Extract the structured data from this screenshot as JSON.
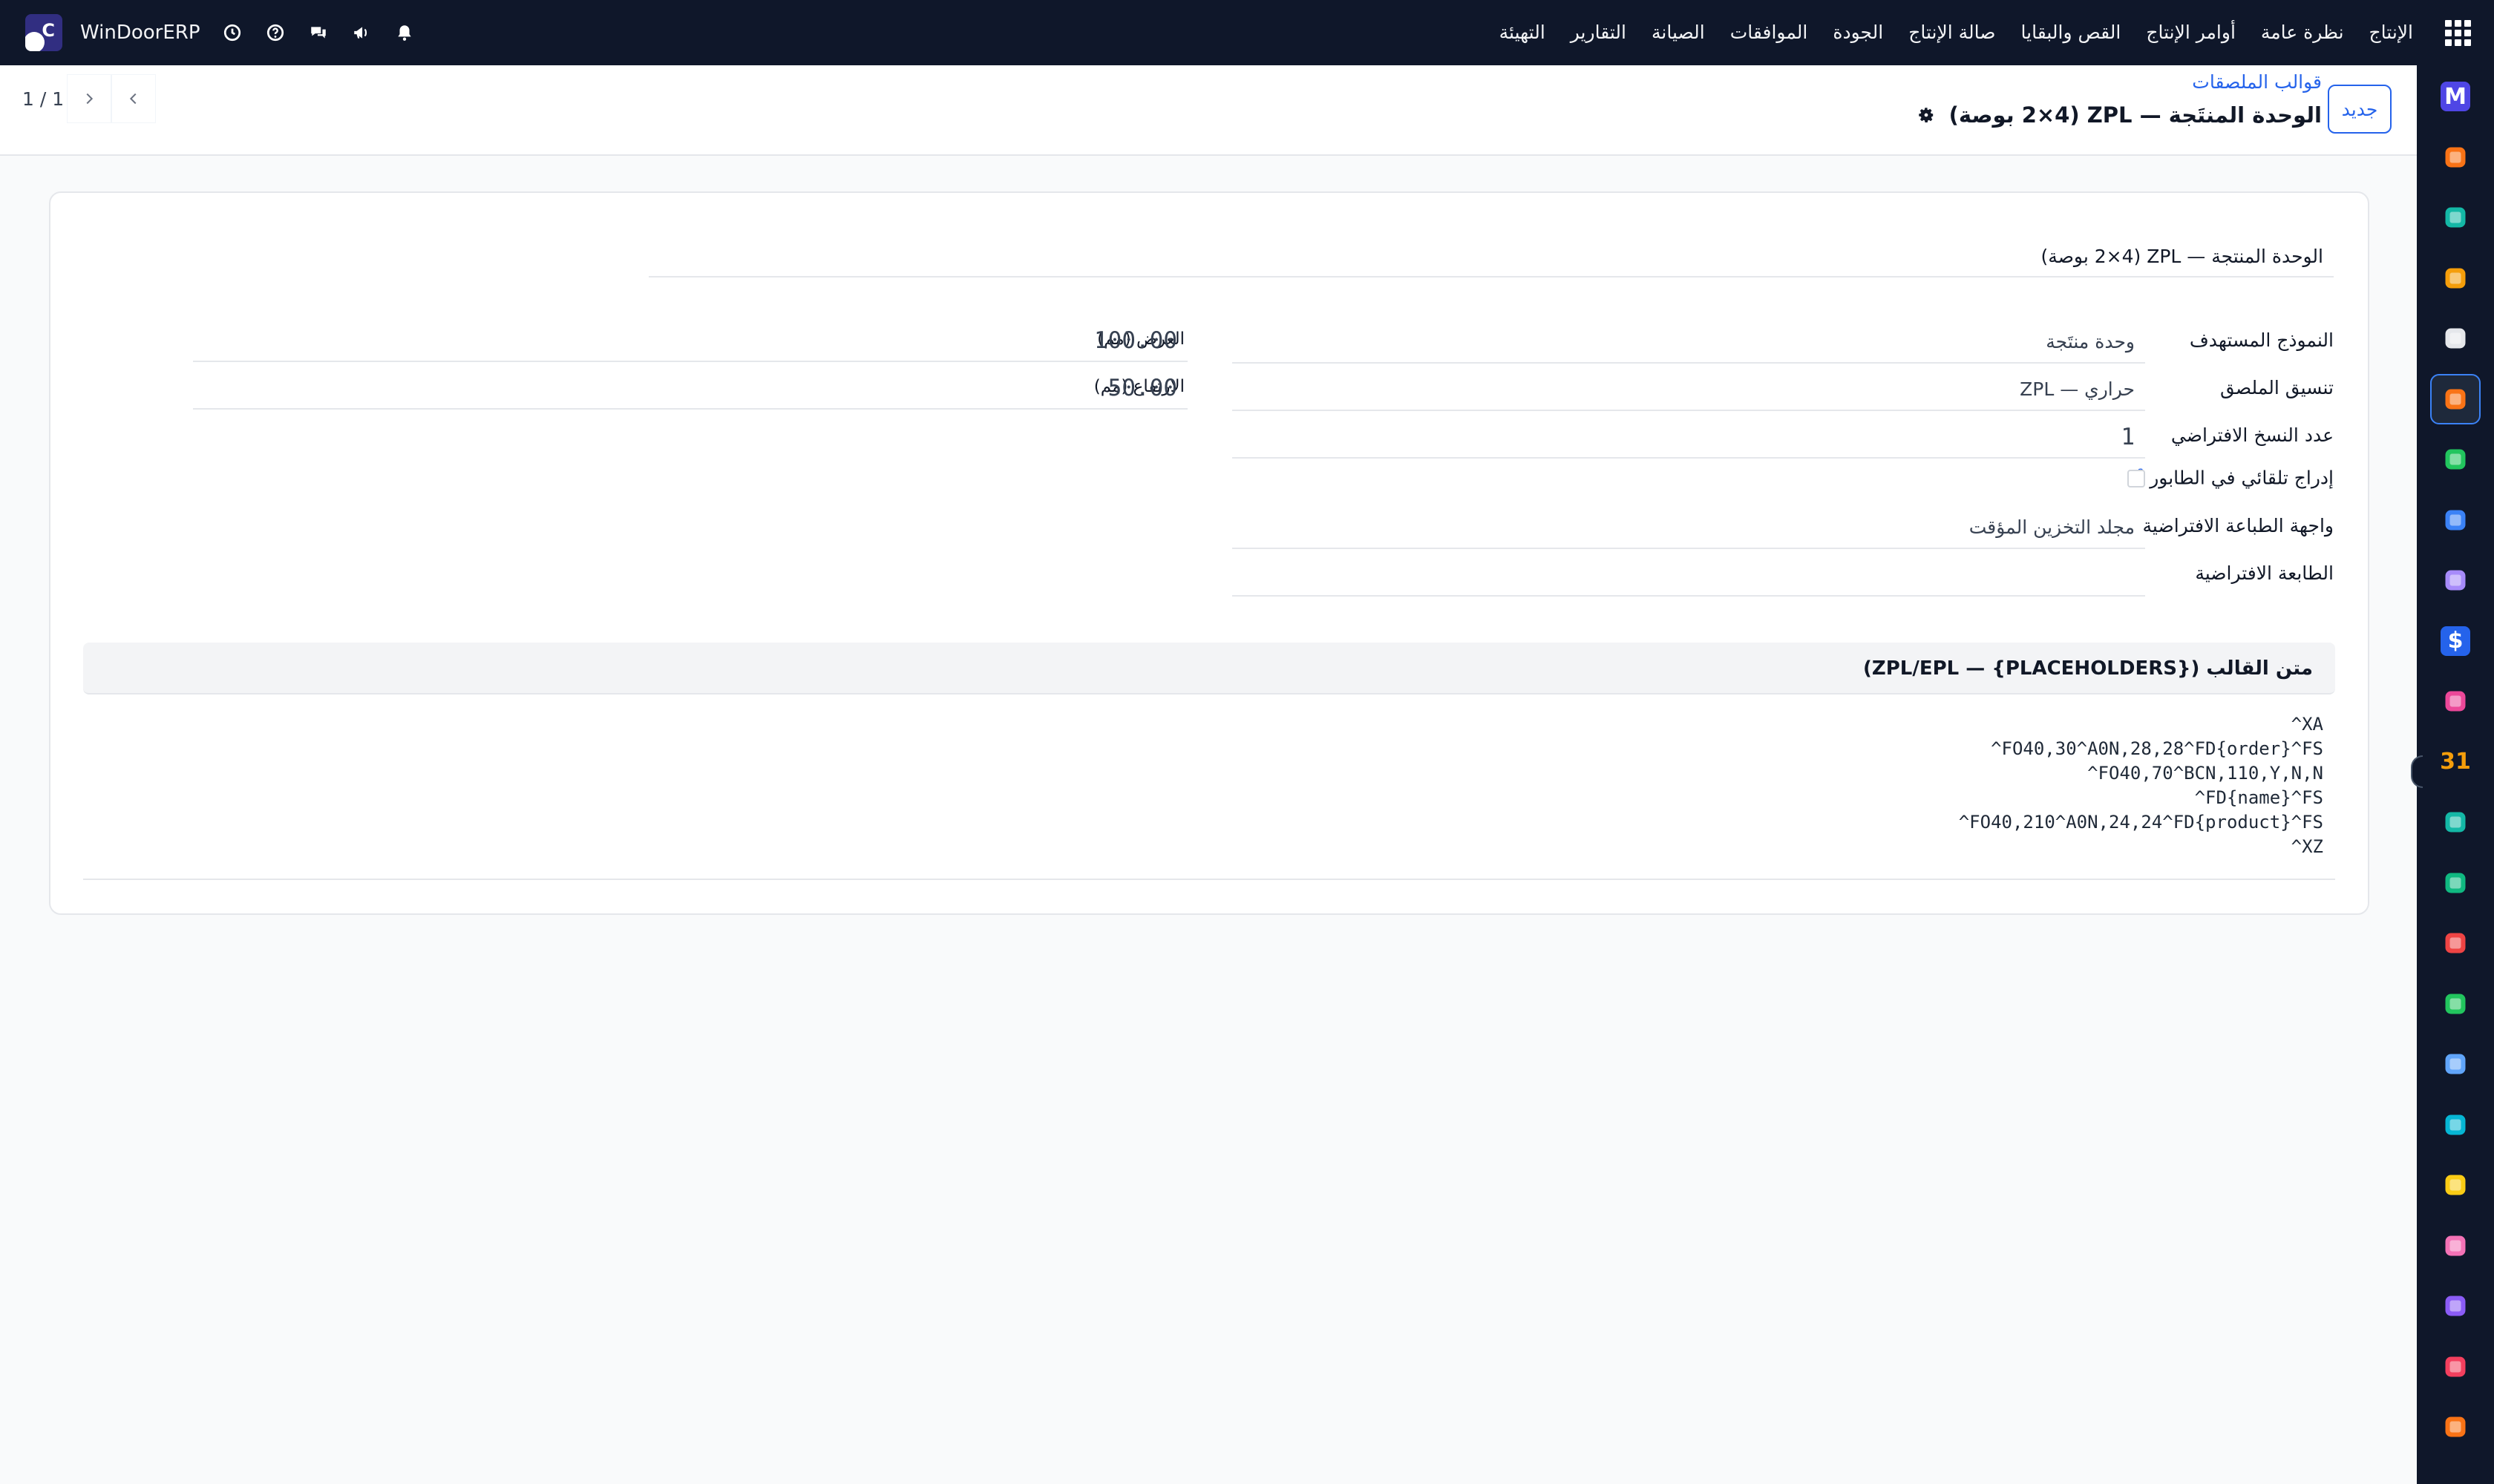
{
  "navbar": {
    "menu": [
      "الإنتاج",
      "نظرة عامة",
      "أوامر الإنتاج",
      "القص والبقايا",
      "صالة الإنتاج",
      "الجودة",
      "الموافقات",
      "الصيانة",
      "التقارير",
      "التهيئة"
    ],
    "company_name": "WinDoorERP",
    "icons": [
      "apps-grid-icon",
      "clock-icon",
      "help-icon",
      "chat-icon",
      "megaphone-icon",
      "bell-icon"
    ]
  },
  "control_panel": {
    "new_label": "جديد",
    "breadcrumb": "قوالب الملصقات",
    "record_title": "الوحدة المنتَجة — ZPL (2×4 بوصة)",
    "pager_value": "1 / 1"
  },
  "form": {
    "name": "الوحدة المنتجة — ZPL (2×4 بوصة)",
    "fields": {
      "target_model": {
        "label": "النموذج المستهدف",
        "value": "وحدة منتَجة"
      },
      "label_format": {
        "label": "تنسيق الملصق",
        "value": "حراري — ZPL"
      },
      "default_copies": {
        "label": "عدد النسخ الافتراضي",
        "value": "1"
      },
      "auto_enqueue": {
        "label": "إدراج تلقائي في الطابور",
        "help": "?",
        "checked": false
      },
      "default_interface": {
        "label": "واجهة الطباعة الافتراضية",
        "value": "مجلد التخزين المؤقت"
      },
      "default_printer": {
        "label": "الطابعة الافتراضية",
        "value": ""
      },
      "width": {
        "label": "العرض (مم)",
        "value": "100.00"
      },
      "height": {
        "label": "الارتفاع (مم)",
        "value": "50.00"
      }
    },
    "template_section_title": "متن القالب (ZPL/EPL — {PLACEHOLDERS})",
    "template_lines": [
      "^XA",
      "^FO40,30^A0N,28,28^FD{order}^FS",
      "^FO40,70^BCN,110,Y,N,N",
      "^FD{name}^FS",
      "^FO40,210^A0N,24,24^FD{product}^FS",
      "^XZ"
    ]
  },
  "sidebar_apps": [
    {
      "name": "app-m-icon",
      "color": "#4f46e5",
      "glyph": "M"
    },
    {
      "name": "app-chat-bubble-icon",
      "color": "#f97316",
      "glyph": ""
    },
    {
      "name": "app-check-ribbon-icon",
      "color": "#14b8a6",
      "glyph": ""
    },
    {
      "name": "app-bar-chart-icon",
      "color": "#f59e0b",
      "glyph": ""
    },
    {
      "name": "app-box-icon",
      "color": "#e5e7eb",
      "glyph": ""
    },
    {
      "name": "app-label-templates-icon",
      "color": "#f97316",
      "glyph": ""
    },
    {
      "name": "app-checkmark-icon",
      "color": "#22c55e",
      "glyph": ""
    },
    {
      "name": "app-book-icon",
      "color": "#3b82f6",
      "glyph": ""
    },
    {
      "name": "app-package-icon",
      "color": "#a78bfa",
      "glyph": ""
    },
    {
      "name": "app-dollar-icon",
      "color": "#2563eb",
      "glyph": "$"
    },
    {
      "name": "app-team-icon",
      "color": "#ec4899",
      "glyph": ""
    },
    {
      "name": "app-calendar-icon",
      "color": "#f59e0b",
      "glyph": "31"
    },
    {
      "name": "app-sign-icon",
      "color": "#14b8a6",
      "glyph": ""
    },
    {
      "name": "app-contacts-icon",
      "color": "#10b981",
      "glyph": ""
    },
    {
      "name": "app-dashboard-icon",
      "color": "#ef4444",
      "glyph": ""
    },
    {
      "name": "app-whatsapp-icon",
      "color": "#22c55e",
      "glyph": ""
    },
    {
      "name": "app-timer-icon",
      "color": "#60a5fa",
      "glyph": ""
    },
    {
      "name": "app-wave-icon",
      "color": "#06b6d4",
      "glyph": ""
    },
    {
      "name": "app-send-icon",
      "color": "#facc15",
      "glyph": ""
    },
    {
      "name": "app-layers-icon",
      "color": "#f472b6",
      "glyph": ""
    },
    {
      "name": "app-cube-icon",
      "color": "#8b5cf6",
      "glyph": ""
    },
    {
      "name": "app-pie-icon",
      "color": "#f43f5e",
      "glyph": ""
    },
    {
      "name": "app-hexagon-icon",
      "color": "#f97316",
      "glyph": ""
    }
  ],
  "colors": {
    "navbar": "#0f172a",
    "accent": "#2563eb"
  }
}
